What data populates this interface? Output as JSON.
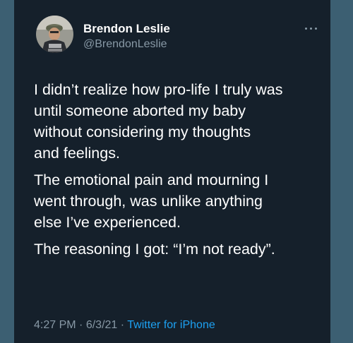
{
  "tweet": {
    "author": {
      "name": "Brendon Leslie",
      "handle": "@BrendonLeslie",
      "avatar_icon": "profile-photo"
    },
    "more_icon": "more-options-icon",
    "paragraphs": [
      "I didn’t realize how pro-life I truly was\nuntil someone aborted my baby\nwithout considering my thoughts\nand feelings.",
      "The emotional pain and mourning I\nwent through, was unlike anything\nelse I’ve experienced.",
      "The reasoning I got: “I’m not ready”."
    ],
    "time": "4:27 PM",
    "separator": "·",
    "date": "6/3/21",
    "source": "Twitter for iPhone"
  },
  "colors": {
    "outer_background": "#3c5f72",
    "card_background": "#15202b",
    "text_primary": "#ffffff",
    "text_secondary": "#8899a6",
    "link": "#1da1f2"
  }
}
